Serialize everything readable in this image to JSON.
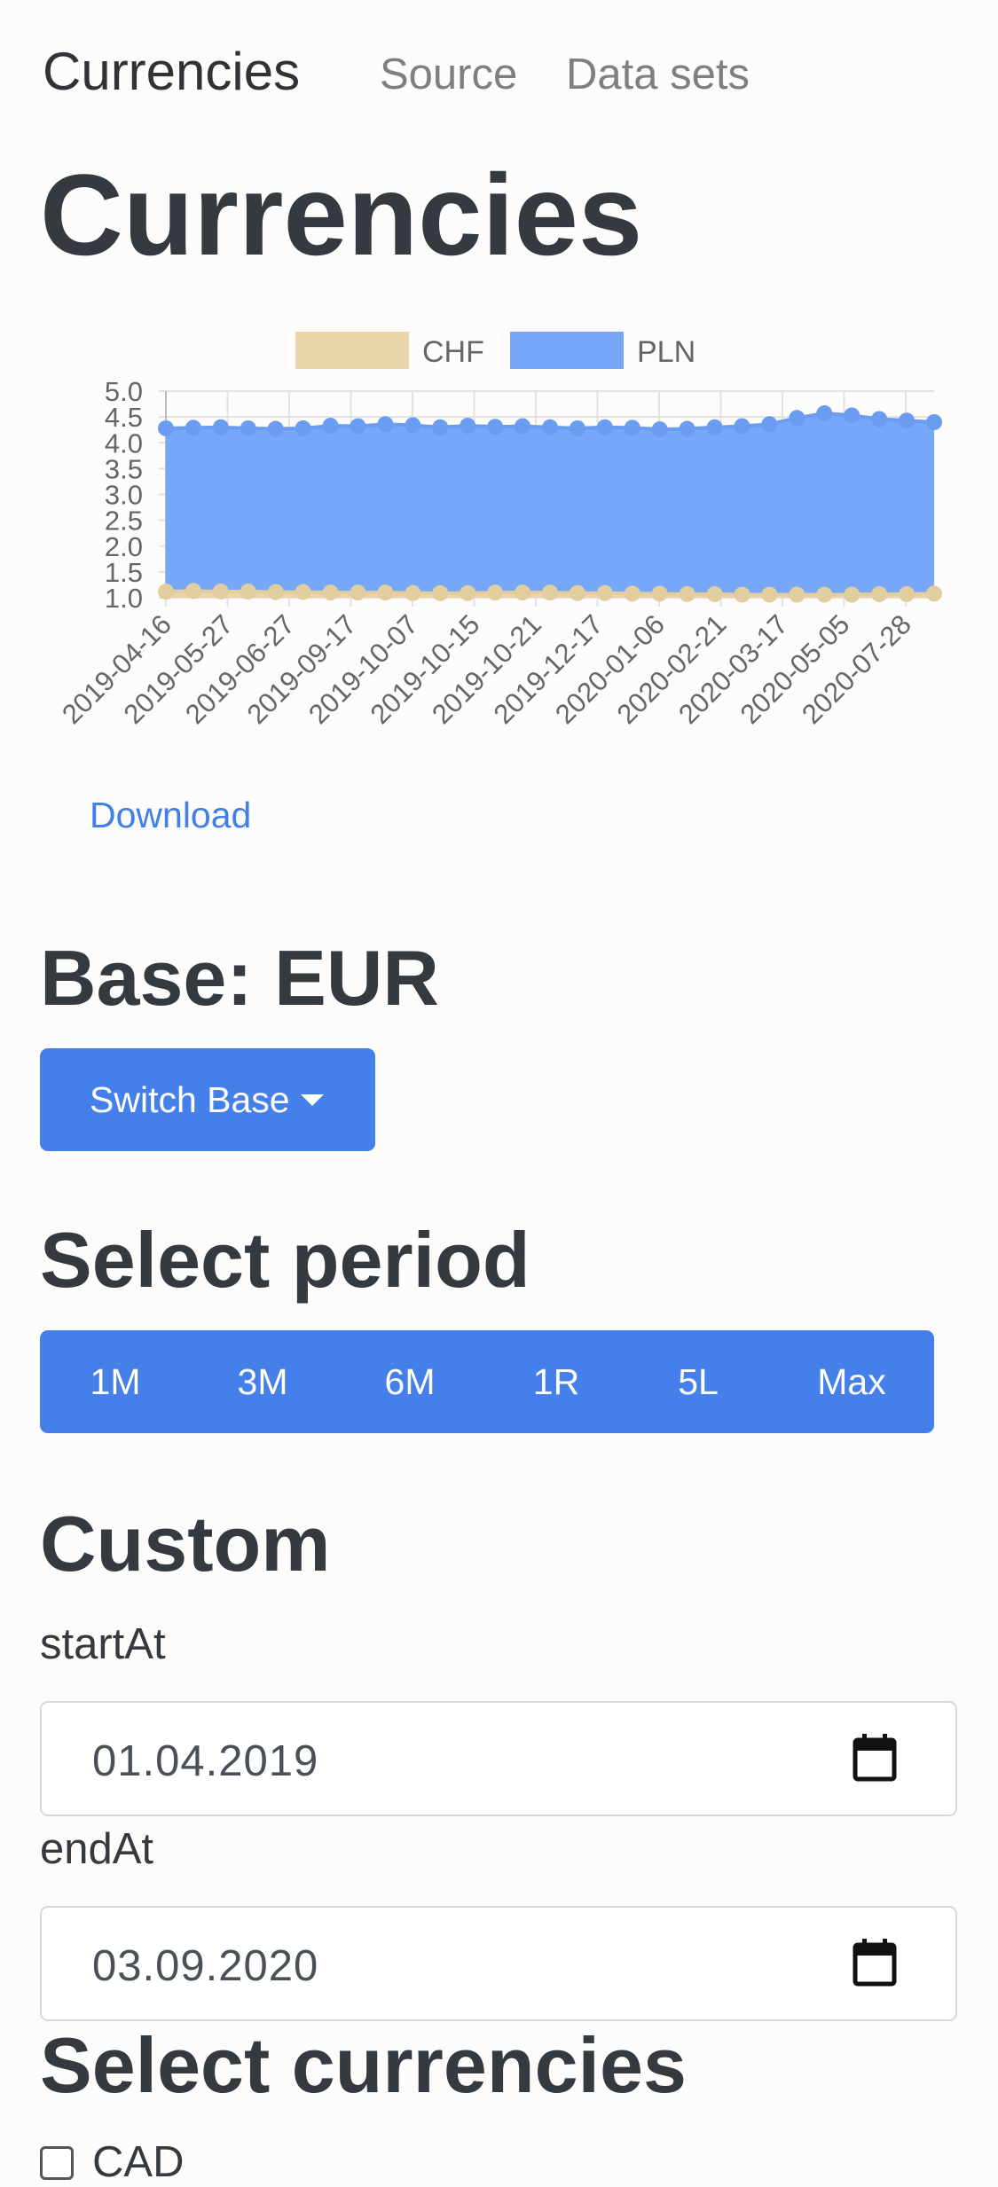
{
  "nav": {
    "brand": "Currencies",
    "links": [
      "Source",
      "Data sets"
    ]
  },
  "page_title": "Currencies",
  "download_label": "Download",
  "base": {
    "heading": "Base: EUR",
    "switch_label": "Switch Base"
  },
  "period": {
    "heading": "Select period",
    "options": [
      "1M",
      "3M",
      "6M",
      "1R",
      "5L",
      "Max"
    ]
  },
  "custom": {
    "heading": "Custom",
    "start_label": "startAt",
    "start_value": "01.04.2019",
    "end_label": "endAt",
    "end_value": "03.09.2020"
  },
  "currencies": {
    "heading": "Select currencies",
    "first_option": "CAD"
  },
  "colors": {
    "primary": "#4580ea",
    "chf": "#ebd4a9",
    "pln": "#77a7f8",
    "pln_point": "#6a9cf2",
    "chf_point": "#e2cd9e"
  },
  "chart_data": {
    "type": "area",
    "legend_position": "top",
    "grid": true,
    "ylim": [
      1.0,
      5.0
    ],
    "yticks": [
      "5.0",
      "4.5",
      "4.0",
      "3.5",
      "3.0",
      "2.5",
      "2.0",
      "1.5",
      "1.0"
    ],
    "xtick_labels": [
      "2019-04-16",
      "2019-05-27",
      "2019-06-27",
      "2019-09-17",
      "2019-10-07",
      "2019-10-15",
      "2019-10-21",
      "2019-12-17",
      "2020-01-06",
      "2020-02-21",
      "2020-03-17",
      "2020-05-05",
      "2020-07-28"
    ],
    "series": [
      {
        "name": "CHF",
        "values": [
          1.12,
          1.13,
          1.12,
          1.12,
          1.11,
          1.11,
          1.1,
          1.1,
          1.1,
          1.09,
          1.09,
          1.09,
          1.1,
          1.1,
          1.1,
          1.09,
          1.09,
          1.08,
          1.08,
          1.07,
          1.07,
          1.06,
          1.06,
          1.06,
          1.06,
          1.06,
          1.07,
          1.07,
          1.08
        ]
      },
      {
        "name": "PLN",
        "values": [
          4.28,
          4.29,
          4.3,
          4.28,
          4.27,
          4.28,
          4.33,
          4.32,
          4.36,
          4.34,
          4.3,
          4.33,
          4.31,
          4.32,
          4.3,
          4.28,
          4.3,
          4.29,
          4.26,
          4.27,
          4.3,
          4.32,
          4.36,
          4.48,
          4.57,
          4.53,
          4.46,
          4.43,
          4.4
        ]
      }
    ]
  }
}
